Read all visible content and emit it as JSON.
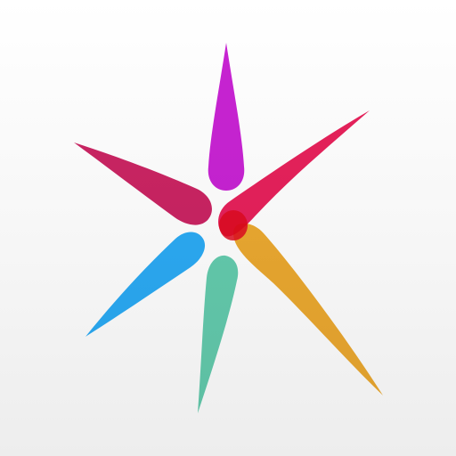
{
  "logo": {
    "name": "star-logo",
    "background_color": "#f4f4f4",
    "rays": [
      {
        "name": "magenta",
        "color": "#c61ad2"
      },
      {
        "name": "crimson",
        "color": "#e5104e"
      },
      {
        "name": "orange",
        "color": "#eba21e"
      },
      {
        "name": "teal",
        "color": "#5ccaaa"
      },
      {
        "name": "blue",
        "color": "#1fa7f5"
      },
      {
        "name": "rose",
        "color": "#c8185a"
      }
    ]
  }
}
